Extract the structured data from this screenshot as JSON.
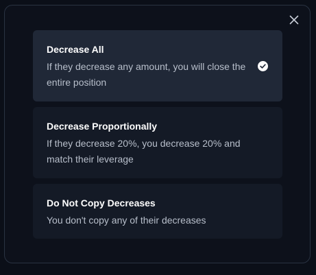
{
  "dialog": {
    "close_icon": "close-icon",
    "options": [
      {
        "title": "Decrease All",
        "description": "If they decrease any amount, you will close the entire position",
        "selected": true,
        "icon": "check-circle-icon"
      },
      {
        "title": "Decrease Proportionally",
        "description": "If they decrease 20%, you decrease 20% and match their leverage",
        "selected": false
      },
      {
        "title": "Do Not Copy Decreases",
        "description": "You don't copy any of their decreases",
        "selected": false
      }
    ]
  },
  "colors": {
    "background": "#0b0f18",
    "modal": "#0d111b",
    "option": "#141a26",
    "option_selected": "#202837",
    "title_text": "#ffffff",
    "desc_text": "#b8bfcb"
  }
}
